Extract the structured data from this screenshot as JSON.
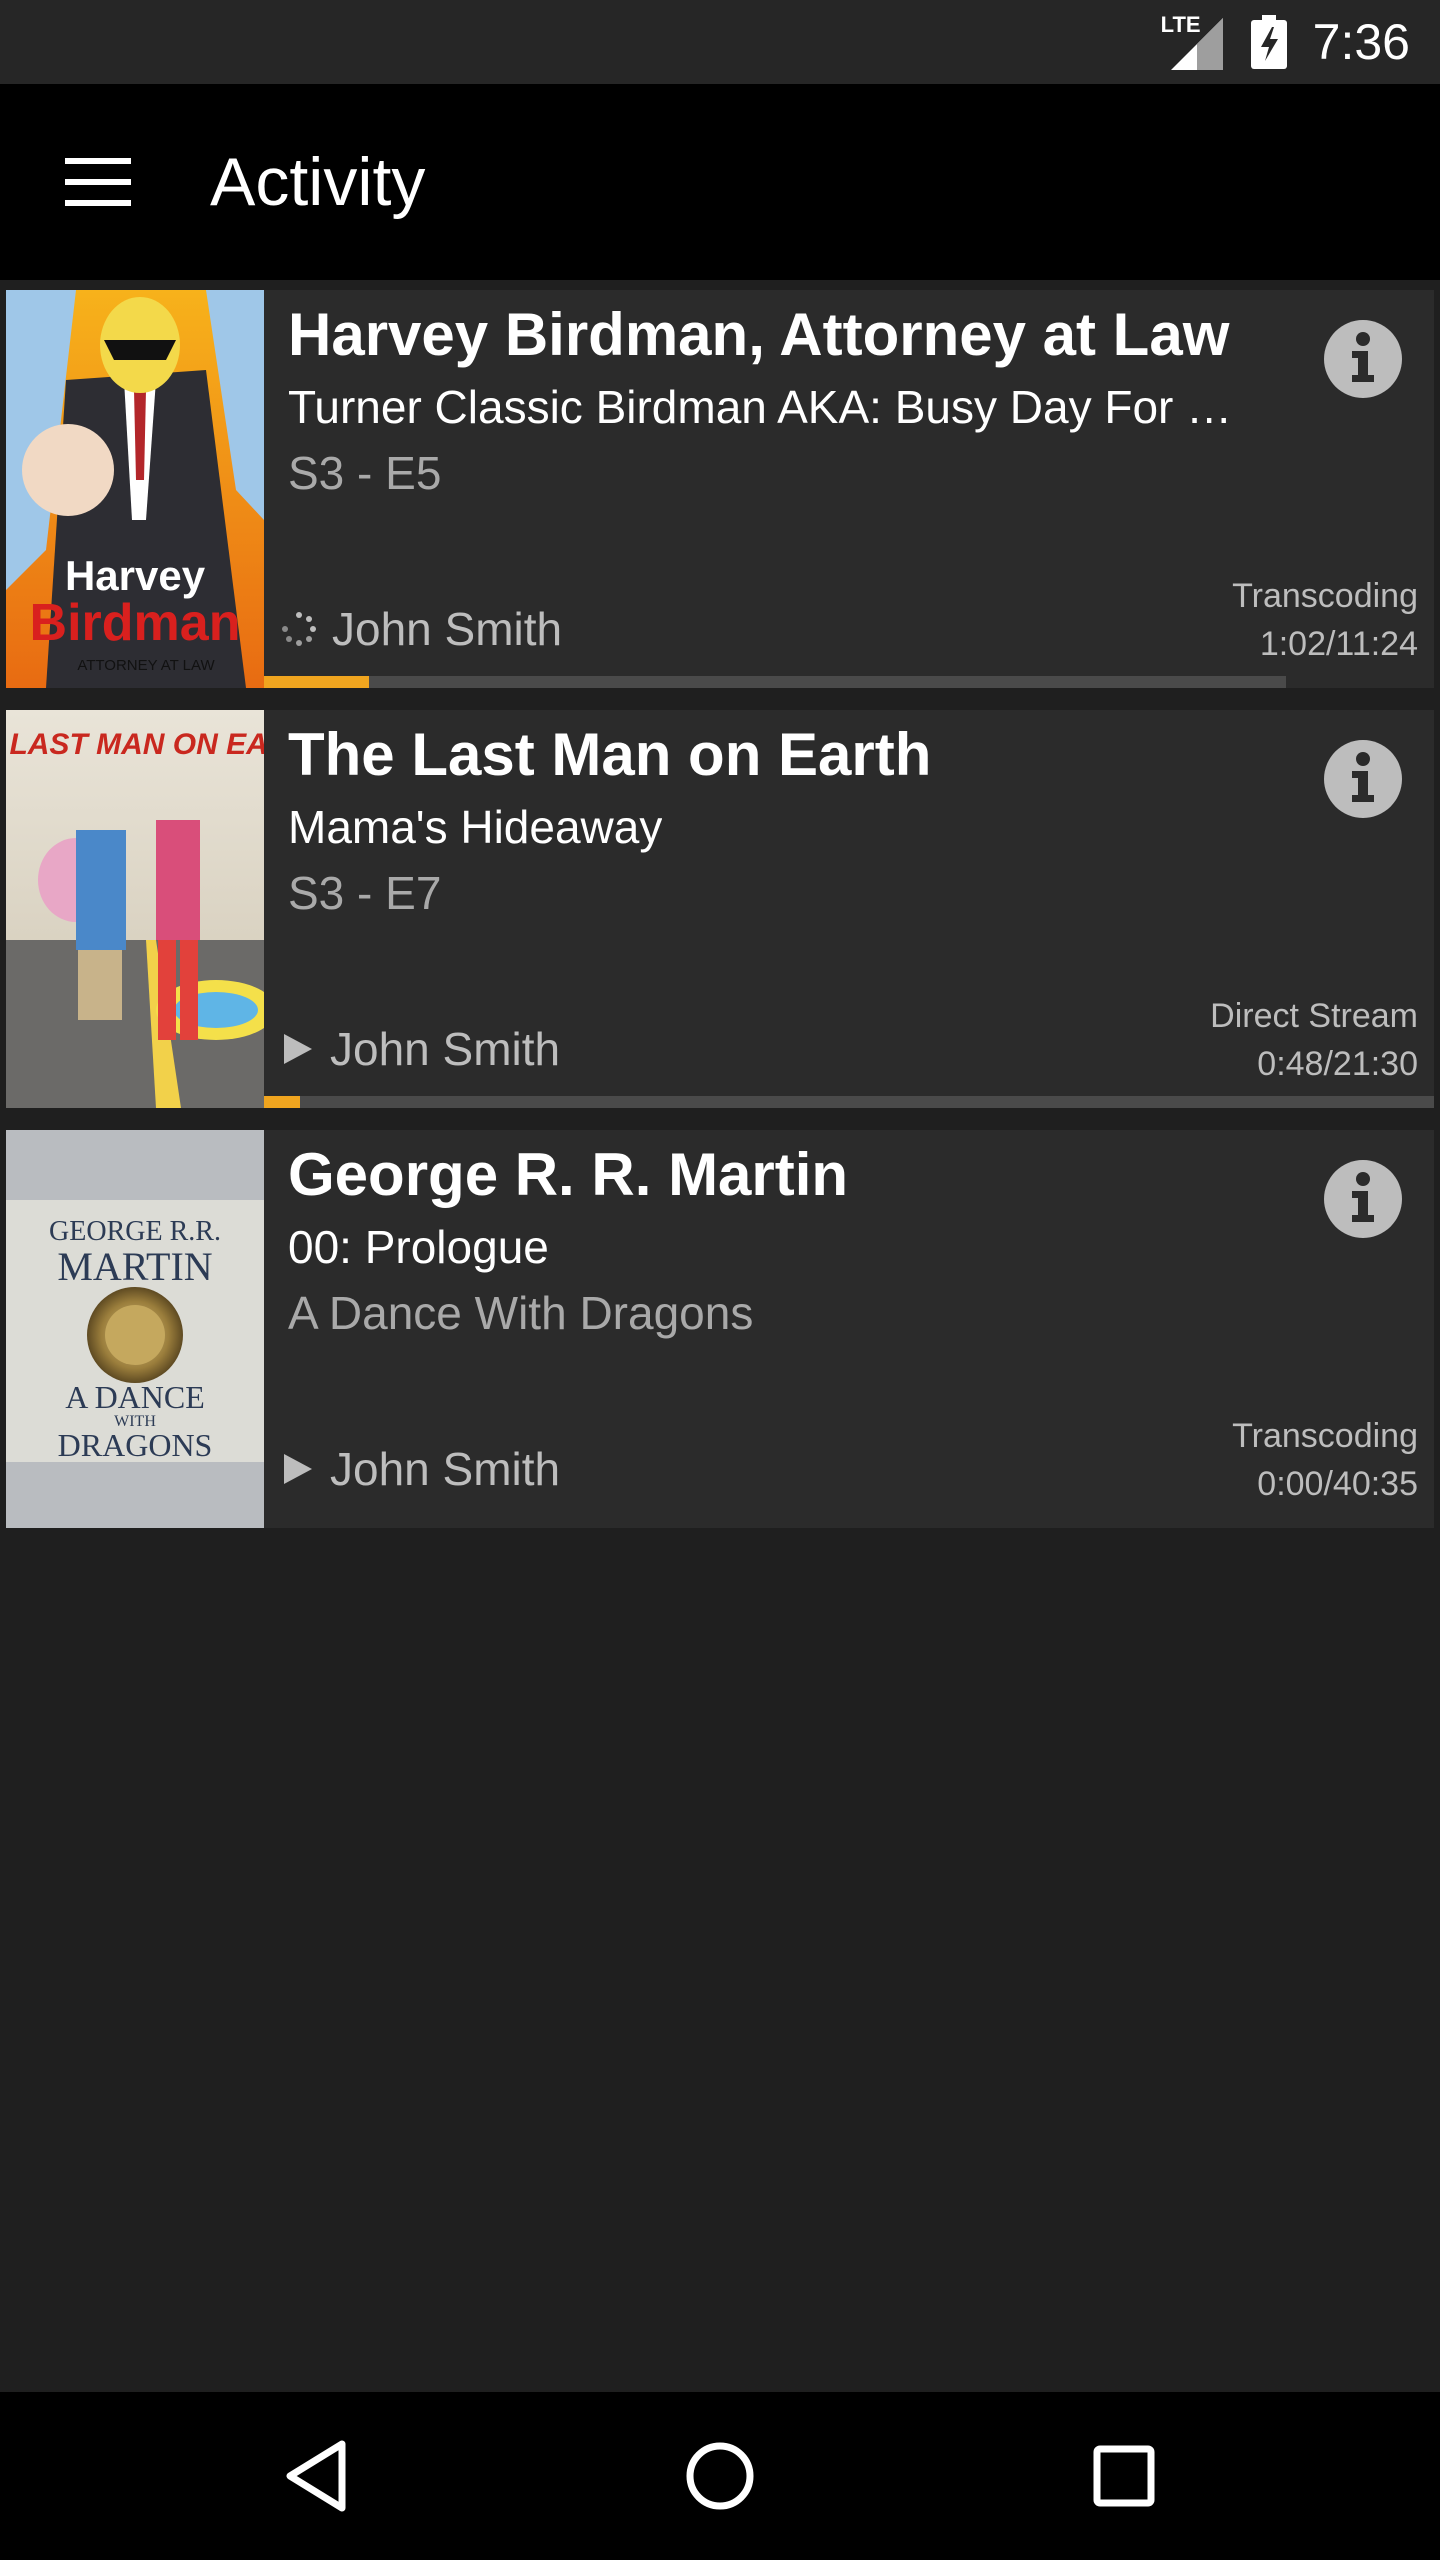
{
  "status_bar": {
    "network": "LTE",
    "time": "7:36"
  },
  "app_bar": {
    "title": "Activity"
  },
  "activities": [
    {
      "title": "Harvey Birdman, Attorney at Law",
      "subtitle": "Turner Classic Birdman AKA: Busy Day For …",
      "detail": "S3 - E5",
      "user": "John Smith",
      "user_icon": "loading-spinner-icon",
      "stream_type": "Transcoding",
      "progress_text": "1:02/11:24",
      "progress_fraction": 0.09,
      "buffered_fraction": 0.92,
      "poster_lines": [
        "Harvey",
        "Birdman",
        "ATTORNEY AT LAW"
      ]
    },
    {
      "title": "The Last Man on Earth",
      "subtitle": "Mama's Hideaway",
      "detail": "S3 - E7",
      "user": "John Smith",
      "user_icon": "play-icon",
      "stream_type": "Direct Stream",
      "progress_text": "0:48/21:30",
      "progress_fraction": 0.04,
      "buffered_fraction": 1.0,
      "poster_lines": [
        "THE LAST MAN ON EARTH"
      ]
    },
    {
      "title": "George R. R. Martin",
      "subtitle": "00: Prologue",
      "detail": "A Dance With Dragons",
      "user": "John Smith",
      "user_icon": "play-icon",
      "stream_type": "Transcoding",
      "progress_text": "0:00/40:35",
      "progress_fraction": 0.0,
      "poster_lines": [
        "GEORGE R.R.",
        "MARTIN",
        "A DANCE",
        "WITH",
        "DRAGONS"
      ]
    }
  ],
  "colors": {
    "accent": "#f0a51f",
    "background": "#1f1f1f",
    "card": "#2b2b2b"
  }
}
